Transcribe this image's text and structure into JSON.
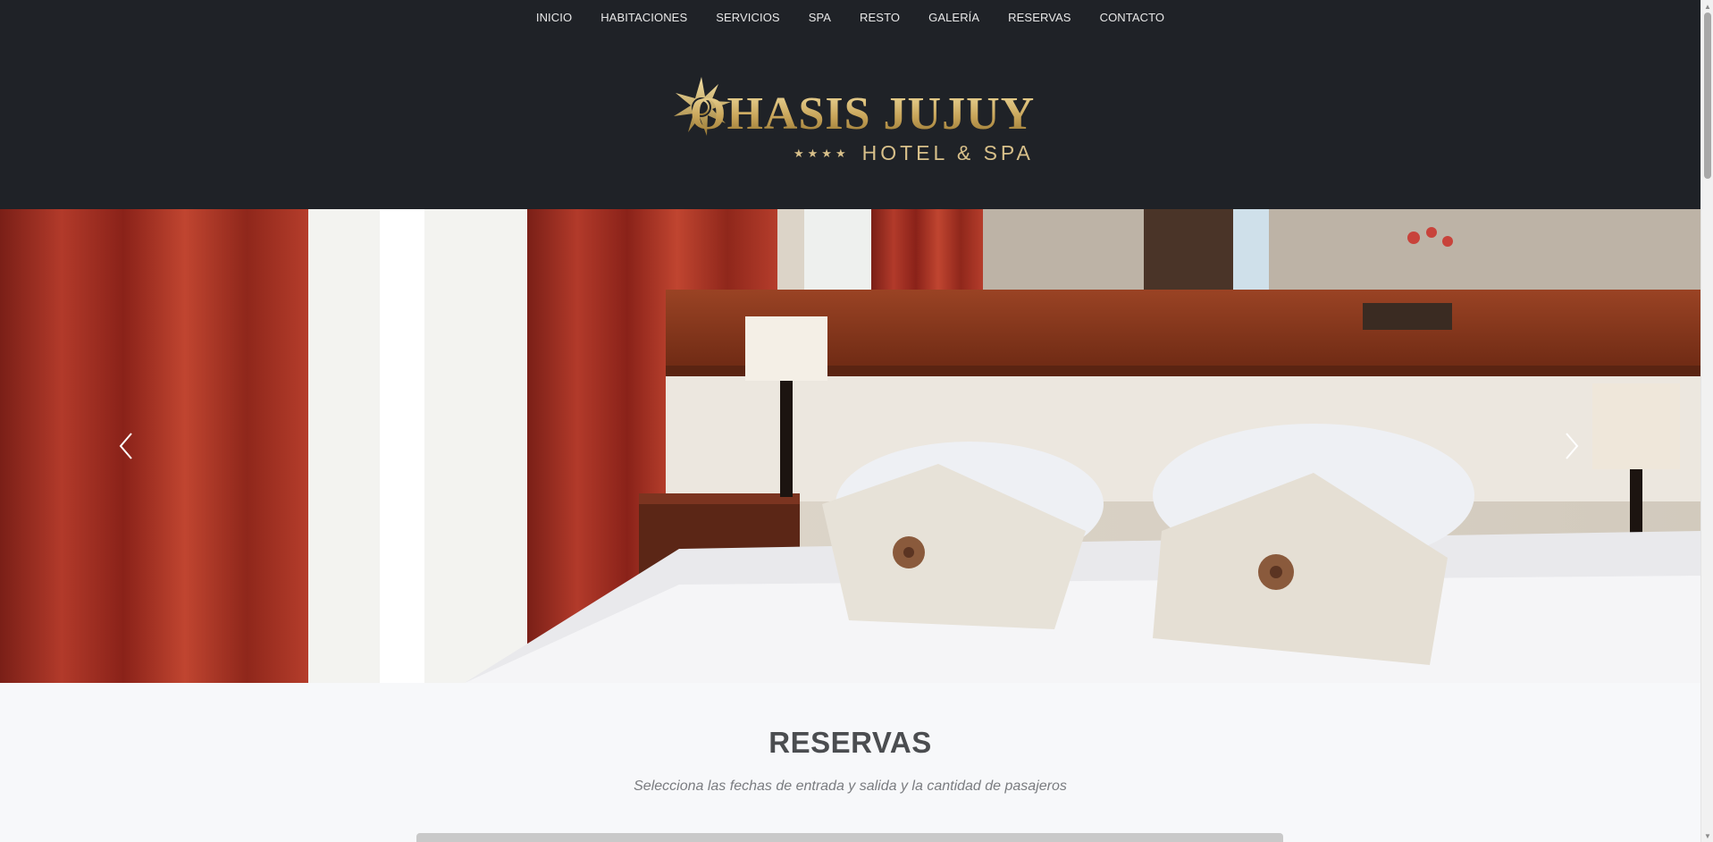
{
  "nav": {
    "items": [
      {
        "label": "INICIO"
      },
      {
        "label": "HABITACIONES"
      },
      {
        "label": "SERVICIOS"
      },
      {
        "label": "SPA"
      },
      {
        "label": "RESTO"
      },
      {
        "label": "GALERÍA"
      },
      {
        "label": "RESERVAS"
      },
      {
        "label": "CONTACTO"
      }
    ]
  },
  "logo": {
    "name": "OHASIS JUJUY",
    "stars": "★★★★",
    "subtitle": "HOTEL & SPA"
  },
  "hero": {
    "prev_icon": "chevron-left-icon",
    "next_icon": "chevron-right-icon"
  },
  "reservas": {
    "title": "RESERVAS",
    "subtitle": "Selecciona las fechas de entrada y salida y la cantidad de pasajeros"
  },
  "colors": {
    "header_bg": "#1f2227",
    "gold": "#d4b56a",
    "page_bg": "#f7f8fa",
    "title_text": "#4b4d50"
  }
}
